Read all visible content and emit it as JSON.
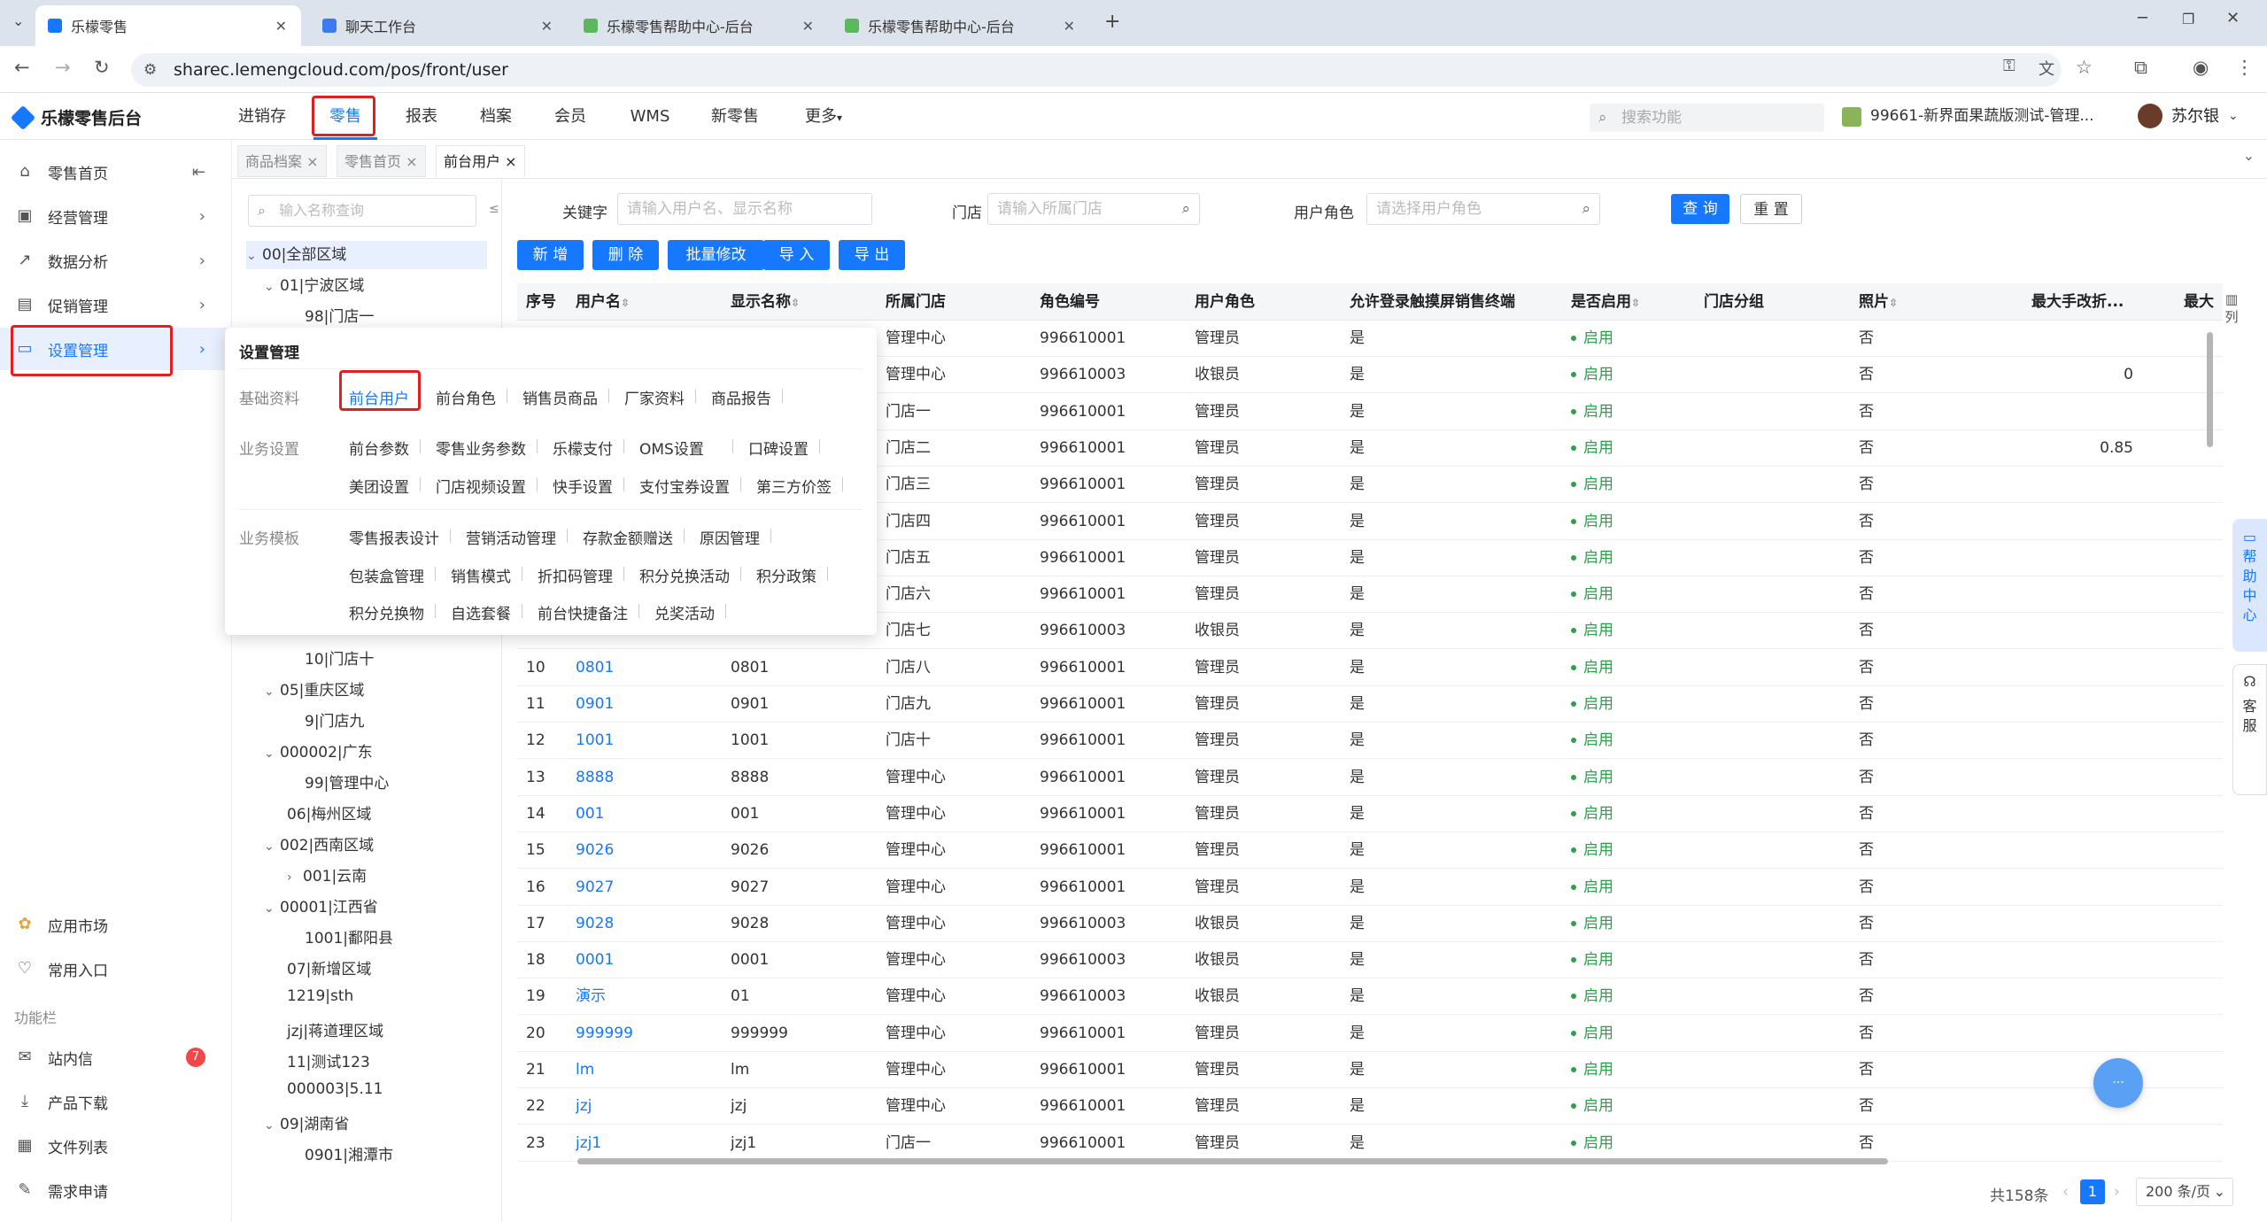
{
  "browser": {
    "tabs": [
      "乐檬零售",
      "聊天工作台",
      "乐檬零售帮助中心-后台",
      "乐檬零售帮助中心-后台"
    ],
    "url": "sharec.lemengcloud.com/pos/front/user"
  },
  "app": {
    "logo": "乐檬零售后台",
    "nav": [
      "进销存",
      "零售",
      "报表",
      "档案",
      "会员",
      "WMS",
      "新零售",
      "更多"
    ],
    "search_placeholder": "搜索功能",
    "store": "99661-新界面果蔬版测试-管理...",
    "user": "苏尔银"
  },
  "leftnav": {
    "items": [
      "零售首页",
      "经营管理",
      "数据分析",
      "促销管理",
      "设置管理"
    ],
    "bottom": [
      "应用市场",
      "常用入口"
    ],
    "section": "功能栏",
    "tools": [
      "站内信",
      "产品下载",
      "文件列表",
      "需求申请"
    ],
    "badge": "7"
  },
  "page_tabs": [
    "商品档案",
    "零售首页",
    "前台用户"
  ],
  "tree": {
    "placeholder": "输入名称查询",
    "nodes": [
      "00|全部区域",
      "01|宁波区域",
      "98|门店一",
      "10|门店十",
      "05|重庆区域",
      "9|门店九",
      "000002|广东",
      "99|管理中心",
      "06|梅州区域",
      "002|西南区域",
      "001|云南",
      "00001|江西省",
      "1001|鄱阳县",
      "07|新增区域",
      "1219|sth",
      "jzj|蒋道理区域",
      "11|测试123",
      "000003|5.11",
      "09|湖南省",
      "0901|湘潭市"
    ]
  },
  "filters": {
    "keyword_label": "关键字",
    "keyword_ph": "请输入用户名、显示名称",
    "store_label": "门店",
    "store_ph": "请输入所属门店",
    "role_label": "用户角色",
    "role_ph": "请选择用户角色",
    "query": "查 询",
    "reset": "重 置"
  },
  "actions": [
    "新 增",
    "删 除",
    "批量修改",
    "导 入",
    "导 出"
  ],
  "table": {
    "headers": [
      "序号",
      "用户名",
      "显示名称",
      "所属门店",
      "角色编号",
      "用户角色",
      "允许登录触摸屏销售终端",
      "是否启用",
      "门店分组",
      "照片",
      "最大手改折...",
      "最大"
    ],
    "rows": [
      [
        "",
        "",
        "",
        "管理中心",
        "996610001",
        "管理员",
        "是",
        "启用",
        "",
        "否",
        ""
      ],
      [
        "",
        "",
        "",
        "管理中心",
        "996610003",
        "收银员",
        "是",
        "启用",
        "",
        "否",
        "0"
      ],
      [
        "",
        "",
        "",
        "门店一",
        "996610001",
        "管理员",
        "是",
        "启用",
        "",
        "否",
        ""
      ],
      [
        "",
        "",
        "",
        "门店二",
        "996610001",
        "管理员",
        "是",
        "启用",
        "",
        "否",
        "0.85"
      ],
      [
        "",
        "",
        "",
        "门店三",
        "996610001",
        "管理员",
        "是",
        "启用",
        "",
        "否",
        ""
      ],
      [
        "",
        "",
        "",
        "门店四",
        "996610001",
        "管理员",
        "是",
        "启用",
        "",
        "否",
        ""
      ],
      [
        "",
        "",
        "",
        "门店五",
        "996610001",
        "管理员",
        "是",
        "启用",
        "",
        "否",
        ""
      ],
      [
        "",
        "",
        "",
        "门店六",
        "996610001",
        "管理员",
        "是",
        "启用",
        "",
        "否",
        ""
      ],
      [
        "",
        "",
        "",
        "门店七",
        "996610003",
        "收银员",
        "是",
        "启用",
        "",
        "否",
        ""
      ],
      [
        "10",
        "0801",
        "0801",
        "门店八",
        "996610001",
        "管理员",
        "是",
        "启用",
        "",
        "否",
        ""
      ],
      [
        "11",
        "0901",
        "0901",
        "门店九",
        "996610001",
        "管理员",
        "是",
        "启用",
        "",
        "否",
        ""
      ],
      [
        "12",
        "1001",
        "1001",
        "门店十",
        "996610001",
        "管理员",
        "是",
        "启用",
        "",
        "否",
        ""
      ],
      [
        "13",
        "8888",
        "8888",
        "管理中心",
        "996610001",
        "管理员",
        "是",
        "启用",
        "",
        "否",
        ""
      ],
      [
        "14",
        "001",
        "001",
        "管理中心",
        "996610001",
        "管理员",
        "是",
        "启用",
        "",
        "否",
        ""
      ],
      [
        "15",
        "9026",
        "9026",
        "管理中心",
        "996610001",
        "管理员",
        "是",
        "启用",
        "",
        "否",
        ""
      ],
      [
        "16",
        "9027",
        "9027",
        "管理中心",
        "996610001",
        "管理员",
        "是",
        "启用",
        "",
        "否",
        ""
      ],
      [
        "17",
        "9028",
        "9028",
        "管理中心",
        "996610003",
        "收银员",
        "是",
        "启用",
        "",
        "否",
        ""
      ],
      [
        "18",
        "0001",
        "0001",
        "管理中心",
        "996610003",
        "收银员",
        "是",
        "启用",
        "",
        "否",
        ""
      ],
      [
        "19",
        "演示",
        "01",
        "管理中心",
        "996610003",
        "收银员",
        "是",
        "启用",
        "",
        "否",
        ""
      ],
      [
        "20",
        "999999",
        "999999",
        "管理中心",
        "996610001",
        "管理员",
        "是",
        "启用",
        "",
        "否",
        ""
      ],
      [
        "21",
        "lm",
        "lm",
        "管理中心",
        "996610001",
        "管理员",
        "是",
        "启用",
        "",
        "否",
        ""
      ],
      [
        "22",
        "jzj",
        "jzj",
        "管理中心",
        "996610001",
        "管理员",
        "是",
        "启用",
        "",
        "否",
        ""
      ],
      [
        "23",
        "jzj1",
        "jzj1",
        "门店一",
        "996610001",
        "管理员",
        "是",
        "启用",
        "",
        "否",
        ""
      ]
    ]
  },
  "popup": {
    "title": "设置管理",
    "sections": [
      "基础资料",
      "业务设置",
      "业务模板"
    ],
    "basic": [
      "前台用户",
      "前台角色",
      "销售员商品",
      "厂家资料",
      "商品报告"
    ],
    "biz1": [
      "前台参数",
      "零售业务参数",
      "乐檬支付",
      "OMS设置",
      "口碑设置"
    ],
    "biz2": [
      "美团设置",
      "门店视频设置",
      "快手设置",
      "支付宝券设置",
      "第三方价签"
    ],
    "tpl1": [
      "零售报表设计",
      "营销活动管理",
      "存款金额赠送",
      "原因管理"
    ],
    "tpl2": [
      "包装盒管理",
      "销售模式",
      "折扣码管理",
      "积分兑换活动",
      "积分政策"
    ],
    "tpl3": [
      "积分兑换物",
      "自选套餐",
      "前台快捷备注",
      "兑奖活动"
    ]
  },
  "side_widgets": {
    "help": "帮助中心",
    "kefu": "客服",
    "col": "列"
  },
  "pagination": {
    "total": "共158条",
    "page": "1",
    "size": "200 条/页"
  },
  "colors": {
    "primary": "#1677ff",
    "enabled": "#2aa24a",
    "highlight": "#e02020"
  }
}
